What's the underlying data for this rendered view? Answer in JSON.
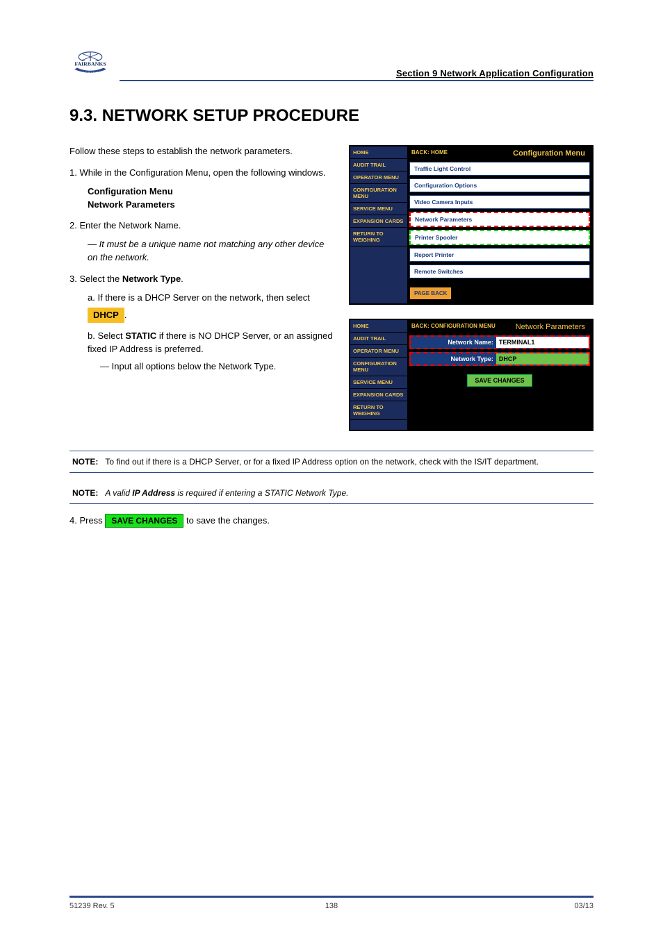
{
  "header": {
    "section_label": "Section 9 Network Application Configuration"
  },
  "title": "9.3.  NETWORK SETUP PROCEDURE",
  "intro": "Follow these steps to establish the network parameters.",
  "steps": {
    "s1": "1.  While in the Configuration Menu, open the following windows.",
    "s1a_label": "Configuration Menu",
    "s1b_label": "Network Parameters",
    "s2": "2.  Enter the Network Name.",
    "s2_note": "It must be a unique name not matching any other device on the network.",
    "s3_pre": "3.  Select the ",
    "s3_link": "Network Type",
    "s3_post": ".",
    "s3a": "a. If there is a DHCP Server on the network, then select",
    "s3a_dhcp": "DHCP",
    "s3a_post": ".",
    "s3b_pre": "b. Select ",
    "s3b_static": "STATIC",
    "s3b_post": " if there is NO DHCP Server, or an assigned fixed IP Address is preferred.",
    "s3b_note": "Input all options below the Network Type."
  },
  "notes": {
    "n1_label": "NOTE:",
    "n1_text": "To find out if there is a DHCP Server, or for a fixed IP Address option on the network, check with the IS/IT department.",
    "n2_label": "NOTE:",
    "n2_pre": "A valid ",
    "n2_ip": "IP Address",
    "n2_post": " is required if entering a STATIC Network Type."
  },
  "final": {
    "pre": "4.  Press ",
    "btn": "SAVE CHANGES",
    "post": " to save the changes."
  },
  "shot1": {
    "nav": [
      "HOME",
      "AUDIT TRAIL",
      "OPERATOR MENU",
      "CONFIGURATION MENU",
      "SERVICE MENU",
      "EXPANSION CARDS",
      "RETURN TO WEIGHING"
    ],
    "back": "BACK: HOME",
    "title": "Configuration Menu",
    "items": [
      "Traffic Light Control",
      "Configuration Options",
      "Video Camera Inputs",
      "Network Parameters",
      "Printer Spooler",
      "Report Printer",
      "Remote Switches"
    ],
    "pageback": "PAGE BACK"
  },
  "shot2": {
    "nav": [
      "HOME",
      "AUDIT TRAIL",
      "OPERATOR MENU",
      "CONFIGURATION MENU",
      "SERVICE MENU",
      "EXPANSION CARDS",
      "RETURN TO WEIGHING"
    ],
    "back": "BACK: CONFIGURATION MENU",
    "title": "Network Parameters",
    "row1_label": "Network Name:",
    "row1_value": "TERMINAL1",
    "row2_label": "Network Type:",
    "row2_value": "DHCP",
    "save": "SAVE CHANGES"
  },
  "footer": {
    "left": "51239 Rev. 5",
    "center": "138",
    "right": "03/13"
  }
}
